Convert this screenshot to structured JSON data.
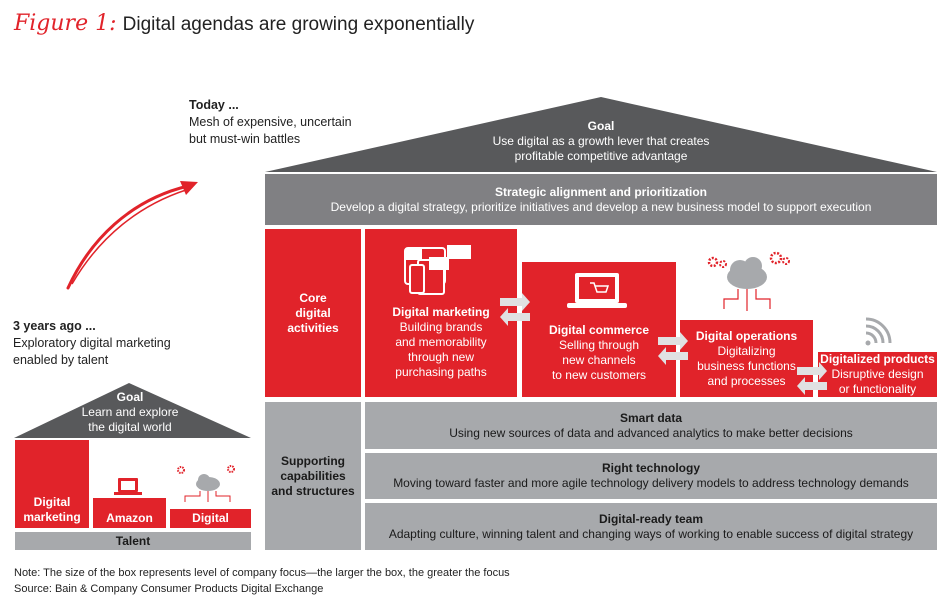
{
  "title": {
    "figure_label": "Figure 1:",
    "text": "Digital agendas are growing exponentially"
  },
  "today": {
    "heading": "Today ...",
    "line1": "Mesh of expensive, uncertain",
    "line2": "but must-win battles"
  },
  "past": {
    "heading": "3 years ago ...",
    "line1": "Exploratory digital marketing",
    "line2": "enabled by talent"
  },
  "today_house": {
    "goal": {
      "title": "Goal",
      "line1": "Use digital as a growth lever that creates",
      "line2": "profitable competitive advantage"
    },
    "strategy": {
      "title": "Strategic alignment and prioritization",
      "text": "Develop a digital strategy, prioritize initiatives and develop a new business model to support execution"
    },
    "core_label": {
      "line1": "Core",
      "line2": "digital",
      "line3": "activities"
    },
    "core": [
      {
        "title": "Digital marketing",
        "lines": [
          "Building brands",
          "and memorability",
          "through new",
          "purchasing paths"
        ]
      },
      {
        "title": "Digital commerce",
        "lines": [
          "Selling through",
          "new channels",
          "to new customers"
        ]
      },
      {
        "title": "Digital operations",
        "lines": [
          "Digitalizing",
          "business functions",
          "and processes"
        ]
      },
      {
        "title": "Digitalized products",
        "lines": [
          "Disruptive design",
          "or functionality"
        ]
      }
    ],
    "support_label": {
      "line1": "Supporting",
      "line2": "capabilities",
      "line3": "and structures"
    },
    "support": [
      {
        "title": "Smart data",
        "text": "Using new sources of data and advanced analytics to make better decisions"
      },
      {
        "title": "Right technology",
        "text": "Moving toward faster and more agile technology delivery models to address technology demands"
      },
      {
        "title": "Digital-ready team",
        "text": "Adapting culture, winning talent and changing ways of working to enable success of digital strategy"
      }
    ]
  },
  "past_house": {
    "goal": {
      "title": "Goal",
      "line1": "Learn and explore",
      "line2": "the digital world"
    },
    "blocks": [
      {
        "line1": "Digital",
        "line2": "marketing"
      },
      {
        "line1": "Amazon"
      },
      {
        "line1": "Digital"
      }
    ],
    "base": "Talent"
  },
  "icons": {
    "ad": "AD"
  },
  "notes": {
    "note": "Note: The size of the box represents level of company focus—the larger the box, the greater the focus",
    "source": "Source: Bain & Company Consumer Products Digital Exchange"
  },
  "colors": {
    "red": "#e1232a",
    "dark_gray": "#58595b",
    "mid_gray": "#808083",
    "light_gray": "#a7a9ac",
    "arrow_gray": "#e0e1e2"
  }
}
